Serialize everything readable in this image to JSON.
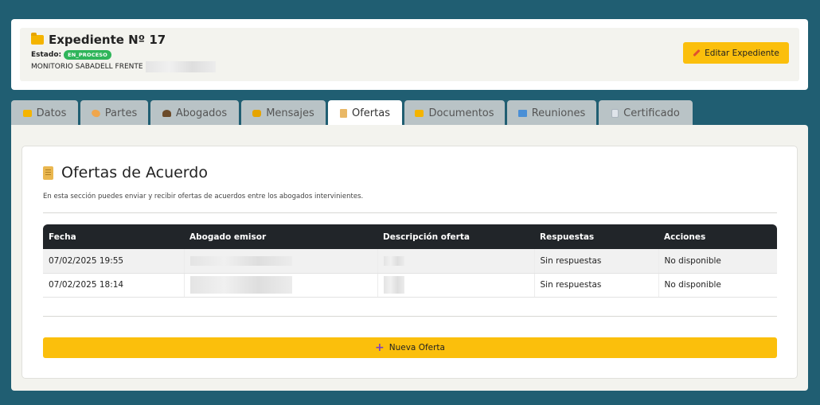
{
  "header": {
    "title": "Expediente Nº 17",
    "estado_label": "Estado:",
    "estado_value": "EN_PROCESO",
    "case_name": "MONITORIO SABADELL FRENTE",
    "edit_button": "Editar Expediente"
  },
  "tabs": [
    {
      "label": "Datos",
      "icon": "folder-icon",
      "active": false
    },
    {
      "label": "Partes",
      "icon": "handshake-icon",
      "active": false
    },
    {
      "label": "Abogados",
      "icon": "lawyer-icon",
      "active": false
    },
    {
      "label": "Mensajes",
      "icon": "lock-icon",
      "active": false
    },
    {
      "label": "Ofertas",
      "icon": "scroll-icon",
      "active": true
    },
    {
      "label": "Documentos",
      "icon": "folder-icon",
      "active": false
    },
    {
      "label": "Reuniones",
      "icon": "calendar-icon",
      "active": false
    },
    {
      "label": "Certificado",
      "icon": "document-icon",
      "active": false
    }
  ],
  "offers": {
    "title": "Ofertas de Acuerdo",
    "description": "En esta sección puedes enviar y recibir ofertas de acuerdos entre los abogados intervinientes.",
    "columns": [
      "Fecha",
      "Abogado emisor",
      "Descripción oferta",
      "Respuestas",
      "Acciones"
    ],
    "rows": [
      {
        "fecha": "07/02/2025 19:55",
        "respuestas": "Sin respuestas",
        "acciones": "No disponible"
      },
      {
        "fecha": "07/02/2025 18:14",
        "respuestas": "Sin respuestas",
        "acciones": "No disponible"
      }
    ],
    "new_button": "Nueva Oferta"
  }
}
